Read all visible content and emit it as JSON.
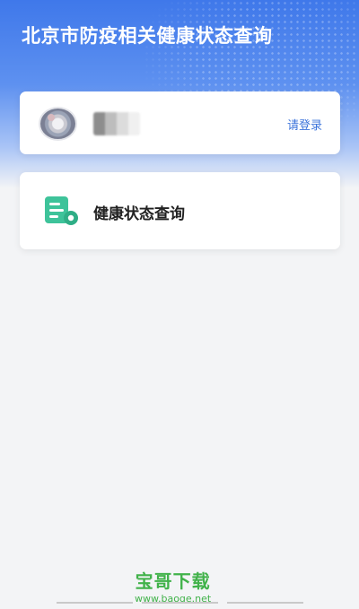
{
  "header": {
    "title": "北京市防疫相关健康状态查询"
  },
  "user_card": {
    "login_label": "请登录"
  },
  "services": [
    {
      "label": "健康状态查询",
      "icon": "health-document-icon"
    }
  ],
  "watermark": {
    "main": "宝哥下载",
    "sub": "www.baoge.net"
  },
  "colors": {
    "header_blue": "#3f78ea",
    "login_link": "#3d74db",
    "service_icon_green": "#3ec39a",
    "watermark_green": "#41b24a"
  }
}
